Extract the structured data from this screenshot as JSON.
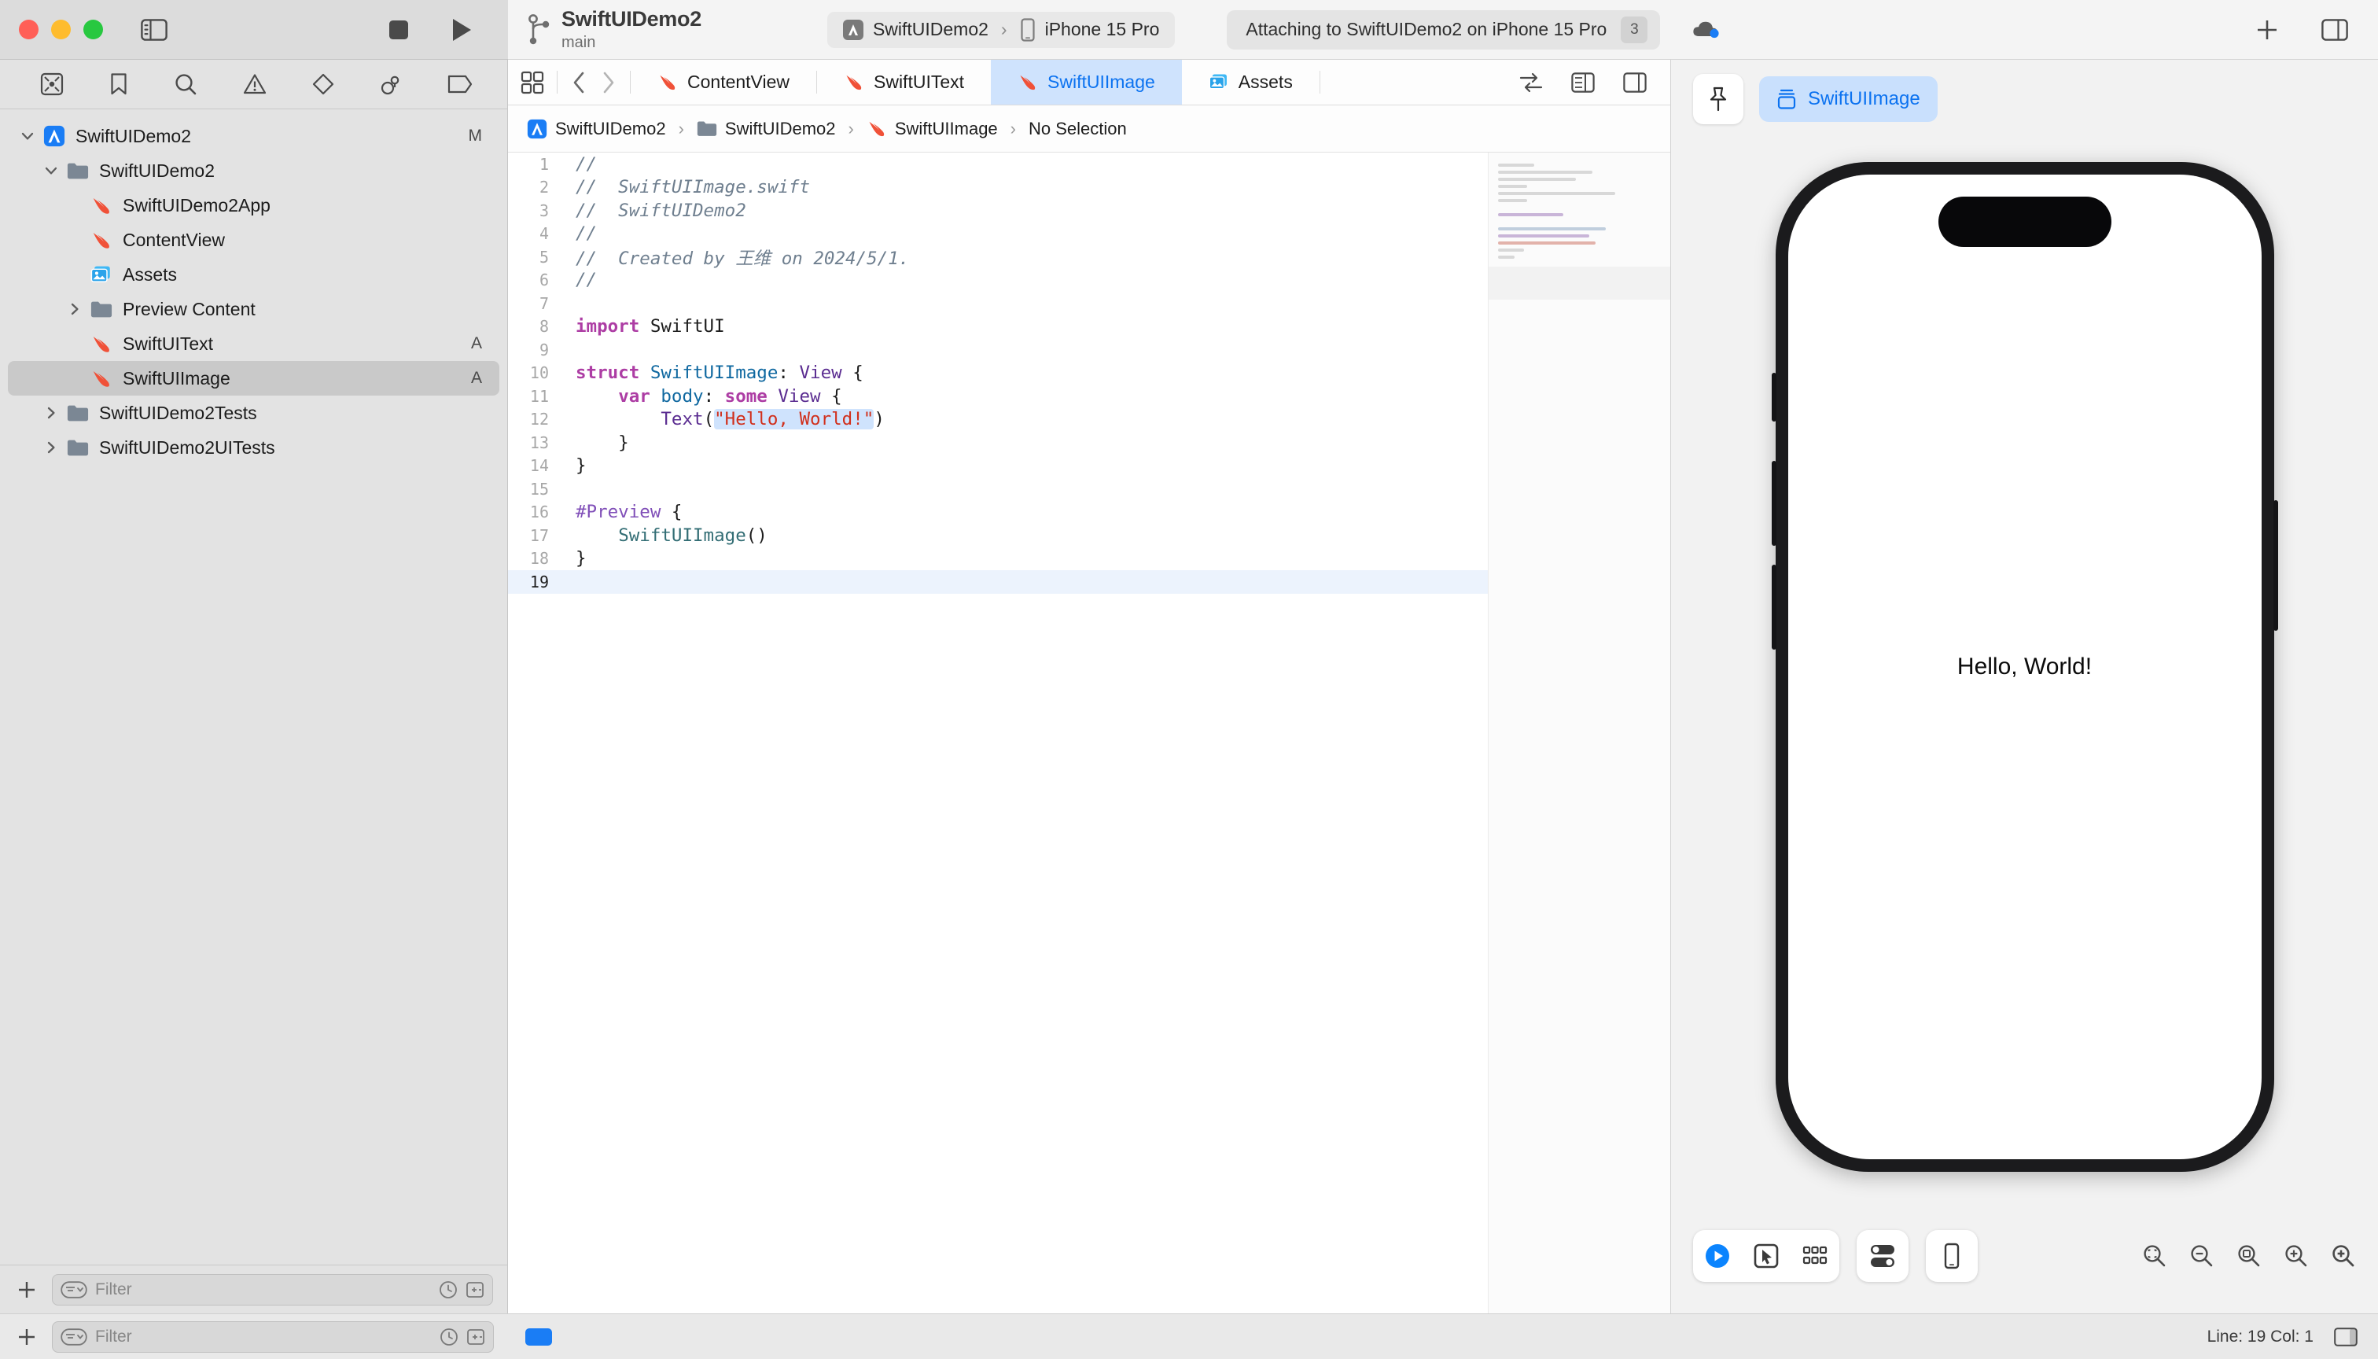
{
  "window": {
    "traffic_lights": [
      "close",
      "minimize",
      "zoom"
    ],
    "sidebar_toggle_icon": "sidebar-left-icon",
    "stop_label": "Stop",
    "run_label": "Run"
  },
  "branch": {
    "project_name": "SwiftUIDemo2",
    "branch_name": "main",
    "icon": "source-control-branch-icon"
  },
  "scheme": {
    "scheme_name": "SwiftUIDemo2",
    "separator": "›",
    "destination": "iPhone 15 Pro",
    "app_icon": "xcode-app-icon",
    "device_icon": "iphone-icon"
  },
  "status": {
    "message": "Attaching to SwiftUIDemo2 on iPhone 15 Pro",
    "badge_count": "3",
    "cloud_icon": "cloud-status-icon"
  },
  "toolbar_right": {
    "add_icon": "plus-icon",
    "inspector_toggle_icon": "sidebar-right-icon"
  },
  "navigator": {
    "tabs": [
      {
        "name": "project-navigator",
        "icon": "folder-icon",
        "active": true
      },
      {
        "name": "source-control-navigator",
        "icon": "source-control-icon",
        "active": false
      },
      {
        "name": "bookmark-navigator",
        "icon": "bookmark-icon",
        "active": false
      },
      {
        "name": "find-navigator",
        "icon": "search-icon",
        "active": false
      },
      {
        "name": "issue-navigator",
        "icon": "warning-triangle-icon",
        "active": false
      },
      {
        "name": "test-navigator",
        "icon": "diamond-icon",
        "active": false
      },
      {
        "name": "debug-navigator",
        "icon": "debug-icon",
        "active": false
      },
      {
        "name": "breakpoint-navigator",
        "icon": "breakpoint-icon",
        "active": false
      },
      {
        "name": "report-navigator",
        "icon": "report-icon",
        "active": false
      }
    ],
    "tree": [
      {
        "label": "SwiftUIDemo2",
        "icon": "xcode-project-icon",
        "indent": 0,
        "disclosure": "down",
        "status": "M",
        "selected": false
      },
      {
        "label": "SwiftUIDemo2",
        "icon": "folder-icon",
        "indent": 1,
        "disclosure": "down",
        "status": "",
        "selected": false
      },
      {
        "label": "SwiftUIDemo2App",
        "icon": "swift-file-icon",
        "indent": 2,
        "disclosure": "none",
        "status": "",
        "selected": false
      },
      {
        "label": "ContentView",
        "icon": "swift-file-icon",
        "indent": 2,
        "disclosure": "none",
        "status": "",
        "selected": false
      },
      {
        "label": "Assets",
        "icon": "assets-icon",
        "indent": 2,
        "disclosure": "none",
        "status": "",
        "selected": false
      },
      {
        "label": "Preview Content",
        "icon": "folder-icon",
        "indent": 2,
        "disclosure": "right",
        "status": "",
        "selected": false
      },
      {
        "label": "SwiftUIText",
        "icon": "swift-file-icon",
        "indent": 2,
        "disclosure": "none",
        "status": "A",
        "selected": false
      },
      {
        "label": "SwiftUIImage",
        "icon": "swift-file-icon",
        "indent": 2,
        "disclosure": "none",
        "status": "A",
        "selected": true
      },
      {
        "label": "SwiftUIDemo2Tests",
        "icon": "folder-icon",
        "indent": 1,
        "disclosure": "right",
        "status": "",
        "selected": false
      },
      {
        "label": "SwiftUIDemo2UITests",
        "icon": "folder-icon",
        "indent": 1,
        "disclosure": "right",
        "status": "",
        "selected": false
      }
    ],
    "filter": {
      "placeholder": "Filter",
      "add_icon": "plus-icon",
      "scope_icon": "filter-scope-icon",
      "recent_icon": "clock-icon",
      "source-control_icon": "source-control-filter-icon"
    }
  },
  "editor": {
    "tab_grid_icon": "tab-grid-icon",
    "back_icon": "chevron-left-icon",
    "forward_icon": "chevron-right-icon",
    "tabs": [
      {
        "label": "ContentView",
        "icon": "swift-file-icon",
        "active": false
      },
      {
        "label": "SwiftUIText",
        "icon": "swift-file-icon",
        "active": false
      },
      {
        "label": "SwiftUIImage",
        "icon": "swift-file-icon",
        "active": true
      },
      {
        "label": "Assets",
        "icon": "assets-icon",
        "active": false
      }
    ],
    "tabbar_right_icons": [
      "code-review-icon",
      "editor-options-icon",
      "add-editor-icon"
    ],
    "breadcrumb": [
      {
        "label": "SwiftUIDemo2",
        "icon": "xcode-project-icon"
      },
      {
        "label": "SwiftUIDemo2",
        "icon": "folder-icon"
      },
      {
        "label": "SwiftUIImage",
        "icon": "swift-file-icon"
      },
      {
        "label": "No Selection",
        "icon": "none"
      }
    ],
    "breadcrumb_separator": "›",
    "code_lines": [
      {
        "n": "1",
        "tokens": [
          {
            "t": "//",
            "c": "cmt"
          }
        ]
      },
      {
        "n": "2",
        "tokens": [
          {
            "t": "//  SwiftUIImage.swift",
            "c": "cmt"
          }
        ]
      },
      {
        "n": "3",
        "tokens": [
          {
            "t": "//  SwiftUIDemo2",
            "c": "cmt"
          }
        ]
      },
      {
        "n": "4",
        "tokens": [
          {
            "t": "//",
            "c": "cmt"
          }
        ]
      },
      {
        "n": "5",
        "tokens": [
          {
            "t": "//  Created by 王维 on 2024/5/1.",
            "c": "cmt"
          }
        ]
      },
      {
        "n": "6",
        "tokens": [
          {
            "t": "//",
            "c": "cmt"
          }
        ]
      },
      {
        "n": "7",
        "tokens": []
      },
      {
        "n": "8",
        "tokens": [
          {
            "t": "import",
            "c": "kw"
          },
          {
            "t": " SwiftUI",
            "c": "plain"
          }
        ]
      },
      {
        "n": "9",
        "tokens": []
      },
      {
        "n": "10",
        "tokens": [
          {
            "t": "struct",
            "c": "kw"
          },
          {
            "t": " ",
            "c": "plain"
          },
          {
            "t": "SwiftUIImage",
            "c": "typ"
          },
          {
            "t": ": ",
            "c": "plain"
          },
          {
            "t": "View",
            "c": "typ2"
          },
          {
            "t": " {",
            "c": "plain"
          }
        ]
      },
      {
        "n": "11",
        "tokens": [
          {
            "t": "    ",
            "c": "plain"
          },
          {
            "t": "var",
            "c": "kw"
          },
          {
            "t": " ",
            "c": "plain"
          },
          {
            "t": "body",
            "c": "typ"
          },
          {
            "t": ": ",
            "c": "plain"
          },
          {
            "t": "some",
            "c": "kw"
          },
          {
            "t": " ",
            "c": "plain"
          },
          {
            "t": "View",
            "c": "typ2"
          },
          {
            "t": " {",
            "c": "plain"
          }
        ]
      },
      {
        "n": "12",
        "tokens": [
          {
            "t": "        ",
            "c": "plain"
          },
          {
            "t": "Text",
            "c": "typ2"
          },
          {
            "t": "(",
            "c": "plain"
          },
          {
            "t": "\"Hello, World!\"",
            "c": "str selstr"
          },
          {
            "t": ")",
            "c": "plain"
          }
        ]
      },
      {
        "n": "13",
        "tokens": [
          {
            "t": "    }",
            "c": "plain"
          }
        ]
      },
      {
        "n": "14",
        "tokens": [
          {
            "t": "}",
            "c": "plain"
          }
        ]
      },
      {
        "n": "15",
        "tokens": []
      },
      {
        "n": "16",
        "tokens": [
          {
            "t": "#Preview",
            "c": "macro"
          },
          {
            "t": " {",
            "c": "plain"
          }
        ]
      },
      {
        "n": "17",
        "tokens": [
          {
            "t": "    ",
            "c": "plain"
          },
          {
            "t": "SwiftUIImage",
            "c": "fn"
          },
          {
            "t": "()",
            "c": "plain"
          }
        ]
      },
      {
        "n": "18",
        "tokens": [
          {
            "t": "}",
            "c": "plain"
          }
        ]
      },
      {
        "n": "19",
        "tokens": [],
        "current": true
      }
    ]
  },
  "canvas": {
    "pin_icon": "pin-icon",
    "preview_chip_label": "SwiftUIImage",
    "preview_chip_icon": "preview-stack-icon",
    "device_preview_text": "Hello, World!",
    "controls": [
      {
        "name": "play-preview-button",
        "icon": "play-circle-icon"
      },
      {
        "name": "selectable-mode-button",
        "icon": "cursor-box-icon"
      },
      {
        "name": "variants-button",
        "icon": "grid-dots-icon"
      }
    ],
    "device_settings_icon": "toggles-icon",
    "device_bezel_icon": "device-frame-icon",
    "zoom_controls": [
      {
        "name": "zoom-fit-button",
        "icon": "zoom-fit-icon"
      },
      {
        "name": "zoom-out-button",
        "icon": "zoom-out-icon"
      },
      {
        "name": "zoom-100-button",
        "icon": "zoom-actual-icon"
      },
      {
        "name": "zoom-in-alt-button",
        "icon": "zoom-in-alt-icon"
      },
      {
        "name": "zoom-in-button",
        "icon": "zoom-in-icon"
      }
    ]
  },
  "statusbar": {
    "add_icon": "plus-icon",
    "filter_placeholder": "Filter",
    "blue_chip": "debug-area-toggle",
    "line_col": "Line: 19  Col: 1",
    "inspector_icon": "inspector-toggle-icon"
  },
  "colors": {
    "accent_blue": "#0b72f0",
    "tab_active_bg": "#cfe3fd",
    "swift_orange": "#f05138",
    "keyword_magenta": "#ad3da4",
    "string_red": "#d12f1b",
    "type_blue": "#0f68a0",
    "macro_purple": "#804fb8",
    "comment_gray": "#6f7f8f"
  }
}
